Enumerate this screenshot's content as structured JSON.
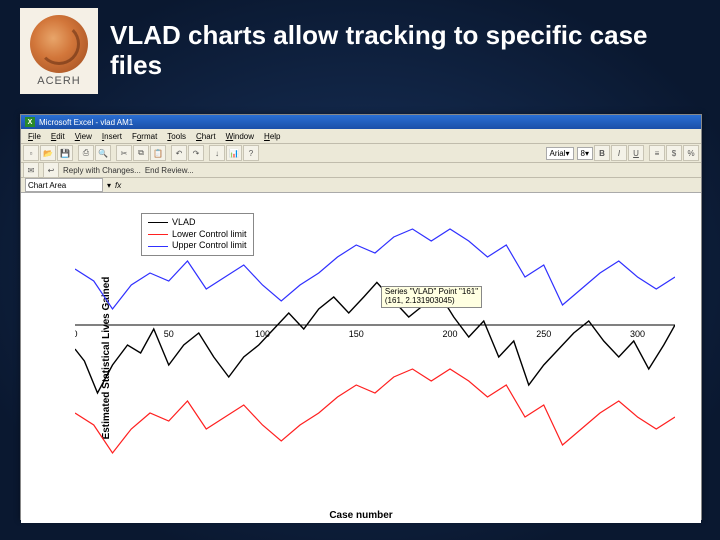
{
  "header": {
    "logo_text": "ACERH",
    "title": "VLAD charts allow tracking to specific case files"
  },
  "excel": {
    "titlebar": "Microsoft Excel - vlad AM1",
    "menus": [
      "File",
      "Edit",
      "View",
      "Insert",
      "Format",
      "Tools",
      "Chart",
      "Window",
      "Help"
    ],
    "font": "Arial",
    "font_size": "8",
    "toolbar2": {
      "reply": "Reply with Changes...",
      "end_review": "End Review..."
    },
    "namebox": "Chart Area"
  },
  "chart_data": {
    "type": "line",
    "xlabel": "Case number",
    "ylabel": "Estimated Statistical Lives Gained",
    "xlim": [
      0,
      320
    ],
    "ylim": [
      -8,
      6
    ],
    "xticks": [
      0,
      50,
      100,
      150,
      200,
      250,
      300
    ],
    "yticks": [
      -8,
      -6,
      -4,
      -2,
      0,
      2,
      4,
      6
    ],
    "tooltip": {
      "line1": "Series \"VLAD\" Point \"161\"",
      "line2": "(161, 2.131903045)",
      "x": 161,
      "y": 2.13
    },
    "series": [
      {
        "name": "VLAD",
        "color": "#000000",
        "x": [
          0,
          5,
          12,
          20,
          28,
          35,
          42,
          50,
          58,
          66,
          74,
          82,
          90,
          98,
          106,
          114,
          122,
          130,
          138,
          146,
          154,
          161,
          170,
          178,
          186,
          194,
          202,
          210,
          218,
          226,
          234,
          242,
          250,
          258,
          266,
          274,
          282,
          290,
          298,
          306,
          314,
          320
        ],
        "y": [
          -1.2,
          -1.8,
          -3.4,
          -2.0,
          -1.0,
          -1.4,
          -0.2,
          -2.0,
          -1.0,
          -0.4,
          -1.6,
          -2.6,
          -1.6,
          -1.0,
          -0.2,
          0.6,
          -0.2,
          0.8,
          1.4,
          0.6,
          1.4,
          2.13,
          1.2,
          0.4,
          1.0,
          1.6,
          0.4,
          -0.6,
          0.2,
          -1.6,
          -0.8,
          -3.0,
          -2.0,
          -1.2,
          -0.4,
          0.2,
          -0.8,
          -1.6,
          -0.8,
          -2.2,
          -1.0,
          0.0
        ]
      },
      {
        "name": "Lower Control limit",
        "color": "#ff2020",
        "x": [
          0,
          10,
          20,
          30,
          40,
          50,
          60,
          70,
          80,
          90,
          100,
          110,
          120,
          130,
          140,
          150,
          160,
          170,
          180,
          190,
          200,
          210,
          220,
          230,
          240,
          250,
          260,
          270,
          280,
          290,
          300,
          310,
          320
        ],
        "y": [
          -4.4,
          -5.0,
          -6.4,
          -5.2,
          -4.4,
          -4.8,
          -3.8,
          -5.2,
          -4.6,
          -4.0,
          -5.0,
          -5.8,
          -5.0,
          -4.4,
          -3.6,
          -3.0,
          -3.4,
          -2.6,
          -2.2,
          -2.8,
          -2.2,
          -2.8,
          -3.6,
          -3.0,
          -4.6,
          -4.0,
          -6.0,
          -5.2,
          -4.4,
          -3.8,
          -4.6,
          -5.2,
          -4.6
        ]
      },
      {
        "name": "Upper Control limit",
        "color": "#3030ff",
        "x": [
          0,
          10,
          20,
          30,
          40,
          50,
          60,
          70,
          80,
          90,
          100,
          110,
          120,
          130,
          140,
          150,
          160,
          170,
          180,
          190,
          200,
          210,
          220,
          230,
          240,
          250,
          260,
          270,
          280,
          290,
          300,
          310,
          320
        ],
        "y": [
          2.8,
          2.2,
          0.8,
          2.0,
          2.6,
          2.2,
          3.2,
          1.8,
          2.4,
          3.0,
          2.0,
          1.2,
          2.0,
          2.6,
          3.4,
          4.0,
          3.6,
          4.4,
          4.8,
          4.2,
          4.8,
          4.2,
          3.4,
          4.0,
          2.4,
          3.0,
          1.0,
          1.8,
          2.6,
          3.2,
          2.4,
          1.8,
          2.4
        ]
      }
    ]
  }
}
